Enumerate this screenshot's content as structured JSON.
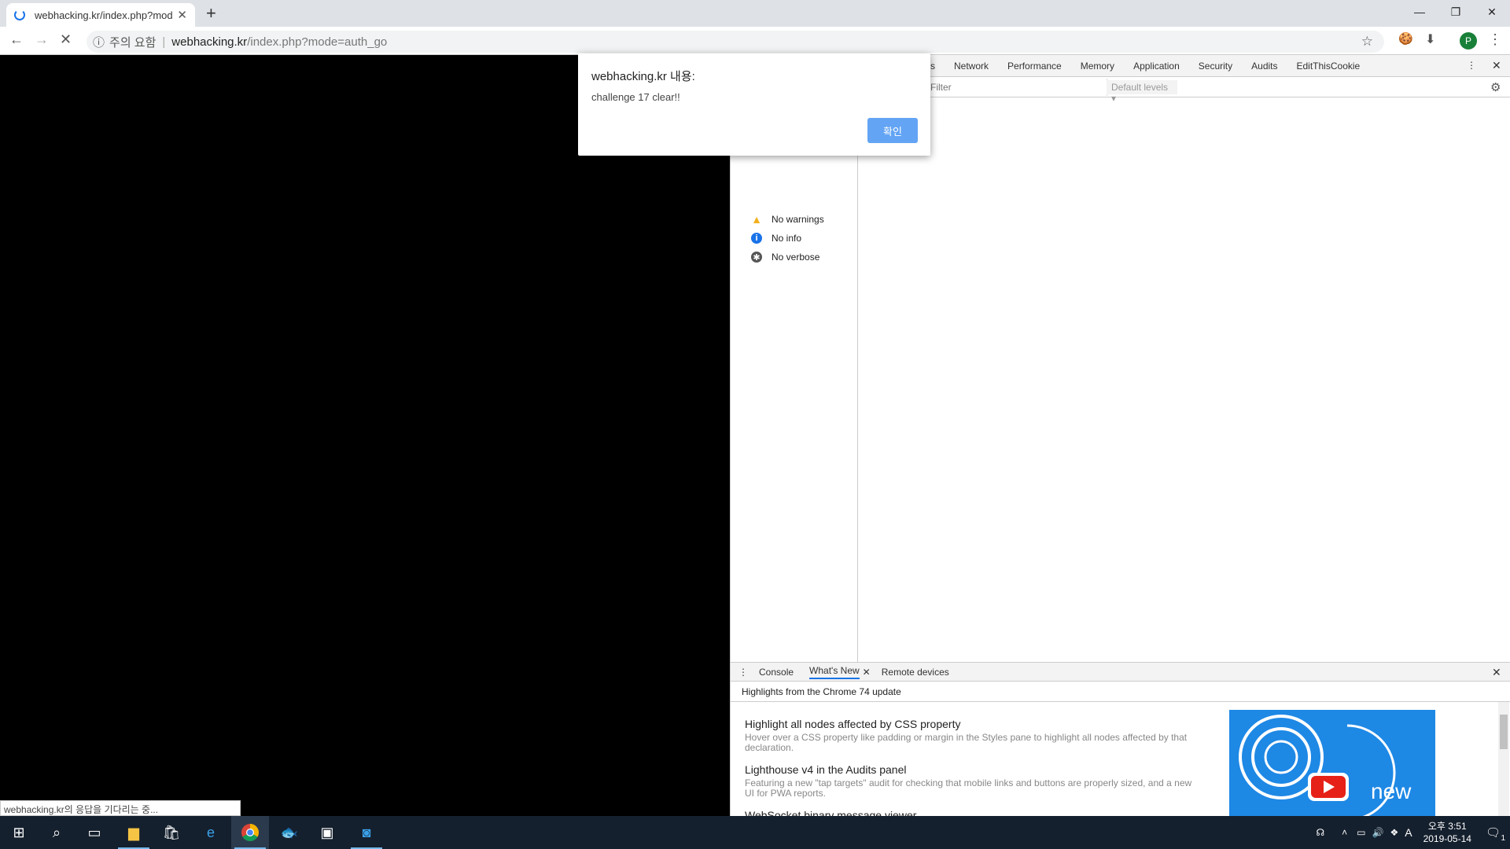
{
  "browser": {
    "tab_title": "webhacking.kr/index.php?mode",
    "new_tab": "+",
    "security_label": "주의 요함",
    "url_host": "webhacking.kr",
    "url_path": "/index.php?mode=auth_go",
    "profile_initial": "P"
  },
  "status_bar": {
    "text": "webhacking.kr의 응답을 기다리는 중..."
  },
  "devtools": {
    "tabs": [
      "s",
      "Network",
      "Performance",
      "Memory",
      "Application",
      "Security",
      "Audits",
      "EditThisCookie"
    ],
    "filter_placeholder": "Filter",
    "levels": "Default levels ▾",
    "sidebar": [
      {
        "label": "No warnings",
        "icon": "warning-icon"
      },
      {
        "label": "No info",
        "icon": "info-icon"
      },
      {
        "label": "No verbose",
        "icon": "bug-icon"
      }
    ],
    "drawer": {
      "tabs": [
        "Console",
        "What's New",
        "Remote devices"
      ],
      "subtitle": "Highlights from the Chrome 74 update",
      "items": [
        {
          "title": "Highlight all nodes affected by CSS property",
          "desc": "Hover over a CSS property like padding or margin in the Styles pane to highlight all nodes affected by that declaration."
        },
        {
          "title": "Lighthouse v4 in the Audits panel",
          "desc": "Featuring a new \"tap targets\" audit for checking that mobile links and buttons are properly sized, and a new UI for PWA reports."
        },
        {
          "title": "WebSocket binary message viewer",
          "desc": ""
        }
      ],
      "promo_text": "new"
    }
  },
  "dialog": {
    "title": "webhacking.kr 내용:",
    "message": "challenge 17 clear!!",
    "ok_label": "확인"
  },
  "taskbar": {
    "time": "오후 3:51",
    "date": "2019-05-14",
    "notifications": "1",
    "ime": "A"
  }
}
